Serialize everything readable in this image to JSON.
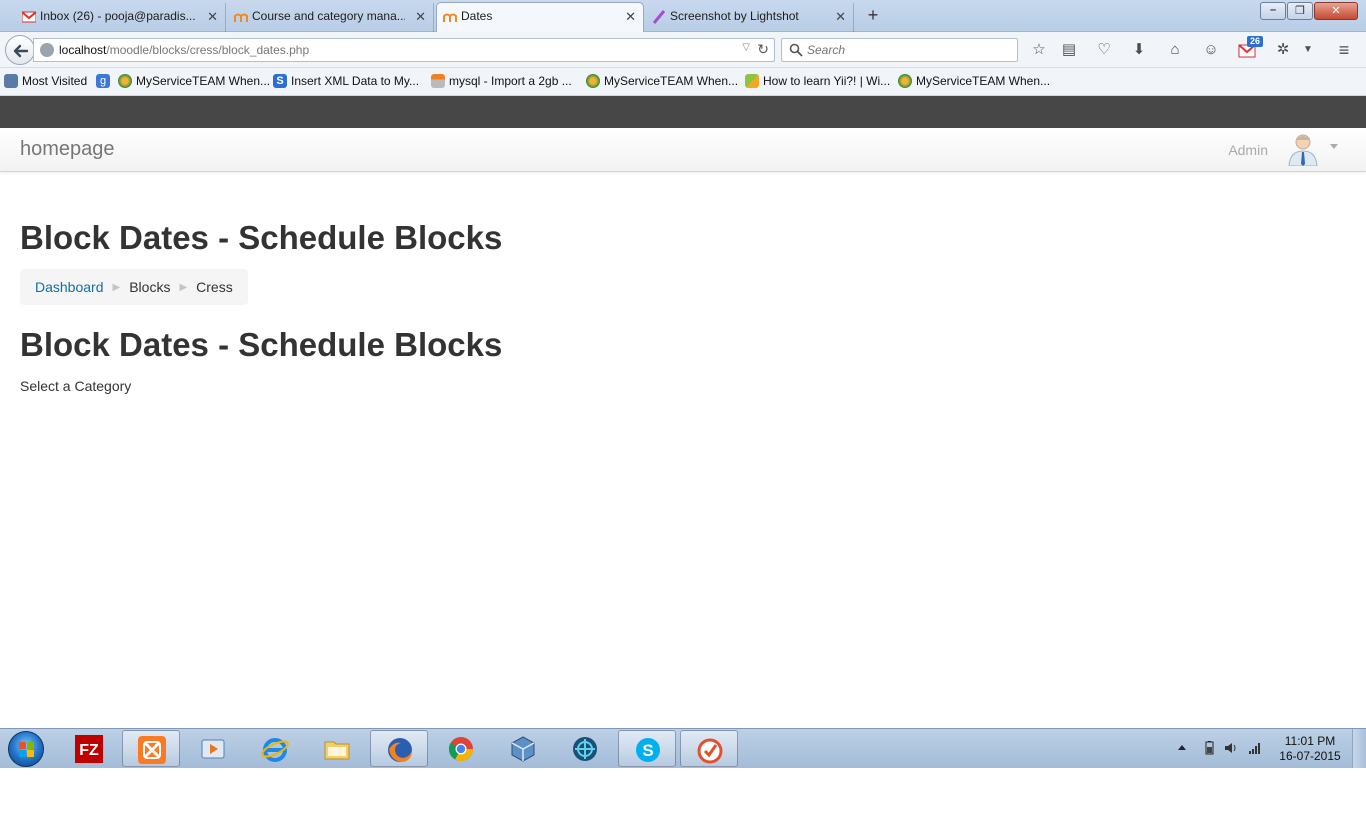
{
  "browser": {
    "tabs": [
      {
        "title": "Inbox (26) - pooja@paradis...",
        "icon": "gmail-icon",
        "active": false
      },
      {
        "title": "Course and category mana...",
        "icon": "moodle-icon",
        "active": false
      },
      {
        "title": "Dates",
        "icon": "moodle-icon",
        "active": true
      },
      {
        "title": "Screenshot by Lightshot",
        "icon": "lightshot-icon",
        "active": false
      }
    ],
    "url_host": "localhost",
    "url_path": "/moodle/blocks/cress/block_dates.php",
    "search_placeholder": "Search",
    "mail_badge": "26",
    "bookmarks": [
      {
        "label": "Most Visited",
        "icon": "most-visited-icon"
      },
      {
        "label": "",
        "icon": "google-icon"
      },
      {
        "label": "MyServiceTEAM When...",
        "icon": "myserviceteam-icon"
      },
      {
        "label": "Insert XML Data to My...",
        "icon": "s-icon"
      },
      {
        "label": "mysql - Import a 2gb ...",
        "icon": "stackoverflow-icon"
      },
      {
        "label": "MyServiceTEAM When...",
        "icon": "myserviceteam-icon"
      },
      {
        "label": "How to learn Yii?! | Wi...",
        "icon": "yii-icon"
      },
      {
        "label": "MyServiceTEAM When...",
        "icon": "myserviceteam-icon"
      }
    ]
  },
  "site": {
    "brand": "homepage",
    "user_name": "Admin"
  },
  "page": {
    "heading": "Block Dates - Schedule Blocks",
    "breadcrumb": [
      "Dashboard",
      "Blocks",
      "Cress"
    ],
    "main_heading": "Block Dates - Schedule Blocks",
    "prompt": "Select a Category"
  },
  "taskbar": {
    "apps": [
      {
        "name": "filezilla",
        "open": false
      },
      {
        "name": "xampp",
        "open": true
      },
      {
        "name": "media-player",
        "open": false
      },
      {
        "name": "internet-explorer",
        "open": false
      },
      {
        "name": "file-explorer",
        "open": false
      },
      {
        "name": "firefox",
        "open": true
      },
      {
        "name": "chrome",
        "open": false
      },
      {
        "name": "virtualbox",
        "open": false
      },
      {
        "name": "app-blue",
        "open": false
      },
      {
        "name": "skype",
        "open": true
      },
      {
        "name": "tasks",
        "open": true
      }
    ],
    "time": "11:01 PM",
    "date": "16-07-2015"
  },
  "colors": {
    "link": "#0f6fa8",
    "topbar": "#474747",
    "heading": "#333333"
  }
}
